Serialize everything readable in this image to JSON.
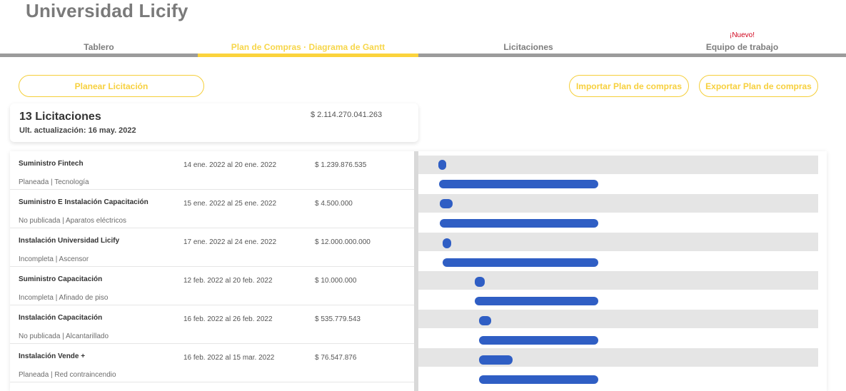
{
  "app": {
    "title": "Universidad Licify"
  },
  "tabs": [
    {
      "label": "Tablero",
      "badge": "",
      "active": false
    },
    {
      "label": "Plan de Compras · Diagrama de Gantt",
      "badge": "",
      "active": true
    },
    {
      "label": "Licitaciones",
      "badge": "",
      "active": false
    },
    {
      "label": "Equipo de trabajo",
      "badge": "¡Nuevo!",
      "active": false
    }
  ],
  "actions": {
    "plan_label": "Planear Licitación",
    "import_label": "Importar Plan de compras",
    "export_label": "Exportar Plan de compras"
  },
  "summary": {
    "count": "13 Licitaciones",
    "updated": "Ult. actualización: 16 may. 2022",
    "total": "$ 2.114.270.041.263"
  },
  "colors": {
    "accent": "#fbd33c",
    "gantt_bar": "#2f5ec4",
    "new_badge": "#d0021b"
  },
  "licitaciones": [
    {
      "name": "Suministro Fintech",
      "meta": "Planeada | Tecnología",
      "dates": "14 ene. 2022 al  20 ene. 2022",
      "amount": "$ 1.239.876.535"
    },
    {
      "name": "Suministro E Instalación Capacitación",
      "meta": "No publicada | Aparatos eléctricos",
      "dates": "15 ene. 2022 al  25 ene. 2022",
      "amount": "$ 4.500.000"
    },
    {
      "name": "Instalación Universidad Licify",
      "meta": "Incompleta | Ascensor",
      "dates": "17 ene. 2022 al  24 ene. 2022",
      "amount": "$ 12.000.000.000"
    },
    {
      "name": "Suministro Capacitación",
      "meta": "Incompleta | Afinado de piso",
      "dates": "12 feb. 2022 al  20 feb. 2022",
      "amount": "$ 10.000.000"
    },
    {
      "name": "Instalación Capacitación",
      "meta": "No publicada | Alcantarillado",
      "dates": "16 feb. 2022 al  26 feb. 2022",
      "amount": "$ 535.779.543"
    },
    {
      "name": "Instalación Vende +",
      "meta": "Planeada | Red contraincendio",
      "dates": "16 feb. 2022 al  15 mar. 2022",
      "amount": "$ 76.547.876"
    }
  ]
}
